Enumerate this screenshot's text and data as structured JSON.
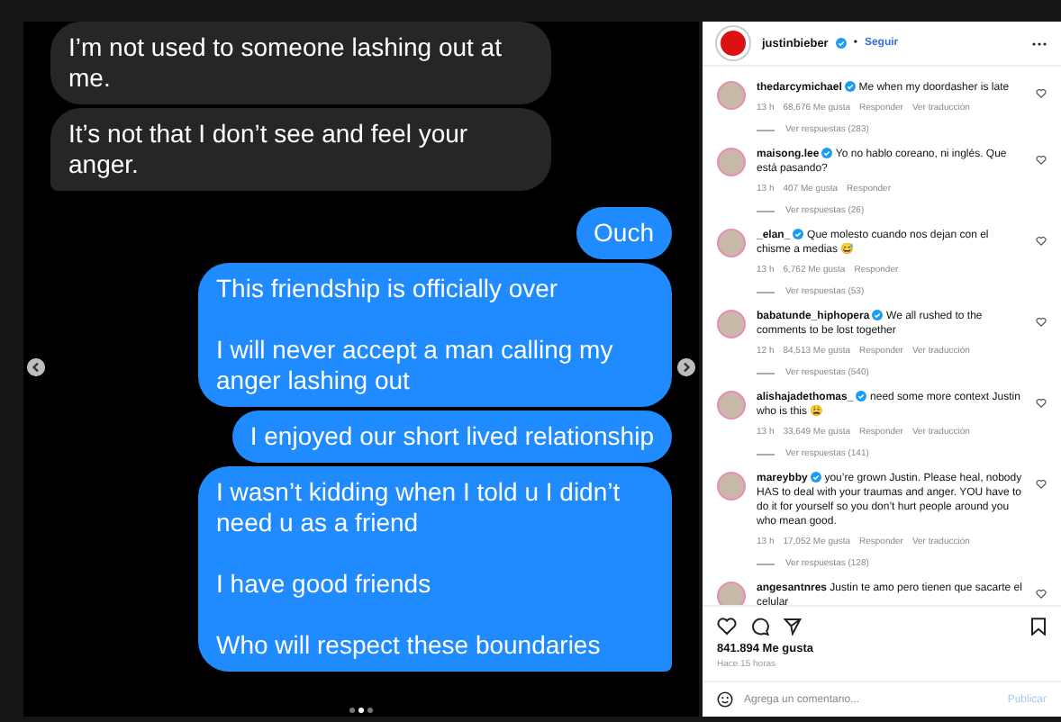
{
  "chat": {
    "messages": [
      {
        "kind": "received",
        "text": "I’m not used to someone lashing out at me.",
        "tail": false
      },
      {
        "kind": "received",
        "text": "It’s not that I don’t see and feel your anger.",
        "tail": true
      },
      {
        "kind": "sent",
        "text": "Ouch",
        "tail": false
      },
      {
        "kind": "sent",
        "text": "This friendship is officially over\n\nI will never accept a man calling my anger lashing out\n",
        "tail": false
      },
      {
        "kind": "sent",
        "text": "I enjoyed our short lived relationship",
        "tail": false
      },
      {
        "kind": "sent",
        "text": "I wasn’t kidding when I told u I didn’t need u as a friend\n\nI have good friends\n\nWho will respect these boundaries",
        "tail": true
      }
    ],
    "carousel": [
      {
        "selected": false
      },
      {
        "selected": true
      },
      {
        "selected": false
      }
    ]
  },
  "post": {
    "author": "justinbieber",
    "verified": true,
    "separator": "•",
    "follow": "Seguir",
    "comments": [
      {
        "user": "thedarcymichael",
        "verified": true,
        "text": "Me when my doordasher is late",
        "time": "13 h",
        "likes": "68,676 Me gusta",
        "reply": "Responder",
        "translate": "Ver traducción",
        "replies": "Ver respuestas (283)"
      },
      {
        "user": "maisong.lee",
        "verified": true,
        "text": "Yo no hablo coreano, ni inglés. Que está pasando?",
        "time": "13 h",
        "likes": "407 Me gusta",
        "reply": "Responder",
        "replies": "Ver respuestas (26)"
      },
      {
        "user": "_elan_",
        "verified": true,
        "text": "Que molesto cuando nos dejan con el chisme a medias 😅",
        "time": "13 h",
        "likes": "6,762 Me gusta",
        "reply": "Responder",
        "replies": "Ver respuestas (53)"
      },
      {
        "user": "babatunde_hiphopera",
        "verified": true,
        "text": "We all rushed to the comments to be lost together",
        "time": "12 h",
        "likes": "84,513 Me gusta",
        "reply": "Responder",
        "translate": "Ver traducción",
        "replies": "Ver respuestas (540)"
      },
      {
        "user": "alishajadethomas_",
        "verified": true,
        "text": "need some more context Justin who is this 😩",
        "time": "13 h",
        "likes": "33,649 Me gusta",
        "reply": "Responder",
        "translate": "Ver traducción",
        "replies": "Ver respuestas (141)"
      },
      {
        "user": "mareybby",
        "verified": true,
        "text": "you’re grown Justin. Please heal, nobody HAS to deal with your traumas and anger. YOU have to do it for yourself so you don’t hurt people around you who mean good.",
        "time": "13 h",
        "likes": "17,052 Me gusta",
        "reply": "Responder",
        "translate": "Ver traducción",
        "replies": "Ver respuestas (128)"
      },
      {
        "user": "angesantnres",
        "text": "Justin te amo pero tienen que sacarte el celular"
      }
    ],
    "likes": "841.894 Me gusta",
    "age": "Hace 15 horas",
    "comment_field": {
      "placeholder": "Agrega un comentario..."
    },
    "publish": "Publicar"
  }
}
